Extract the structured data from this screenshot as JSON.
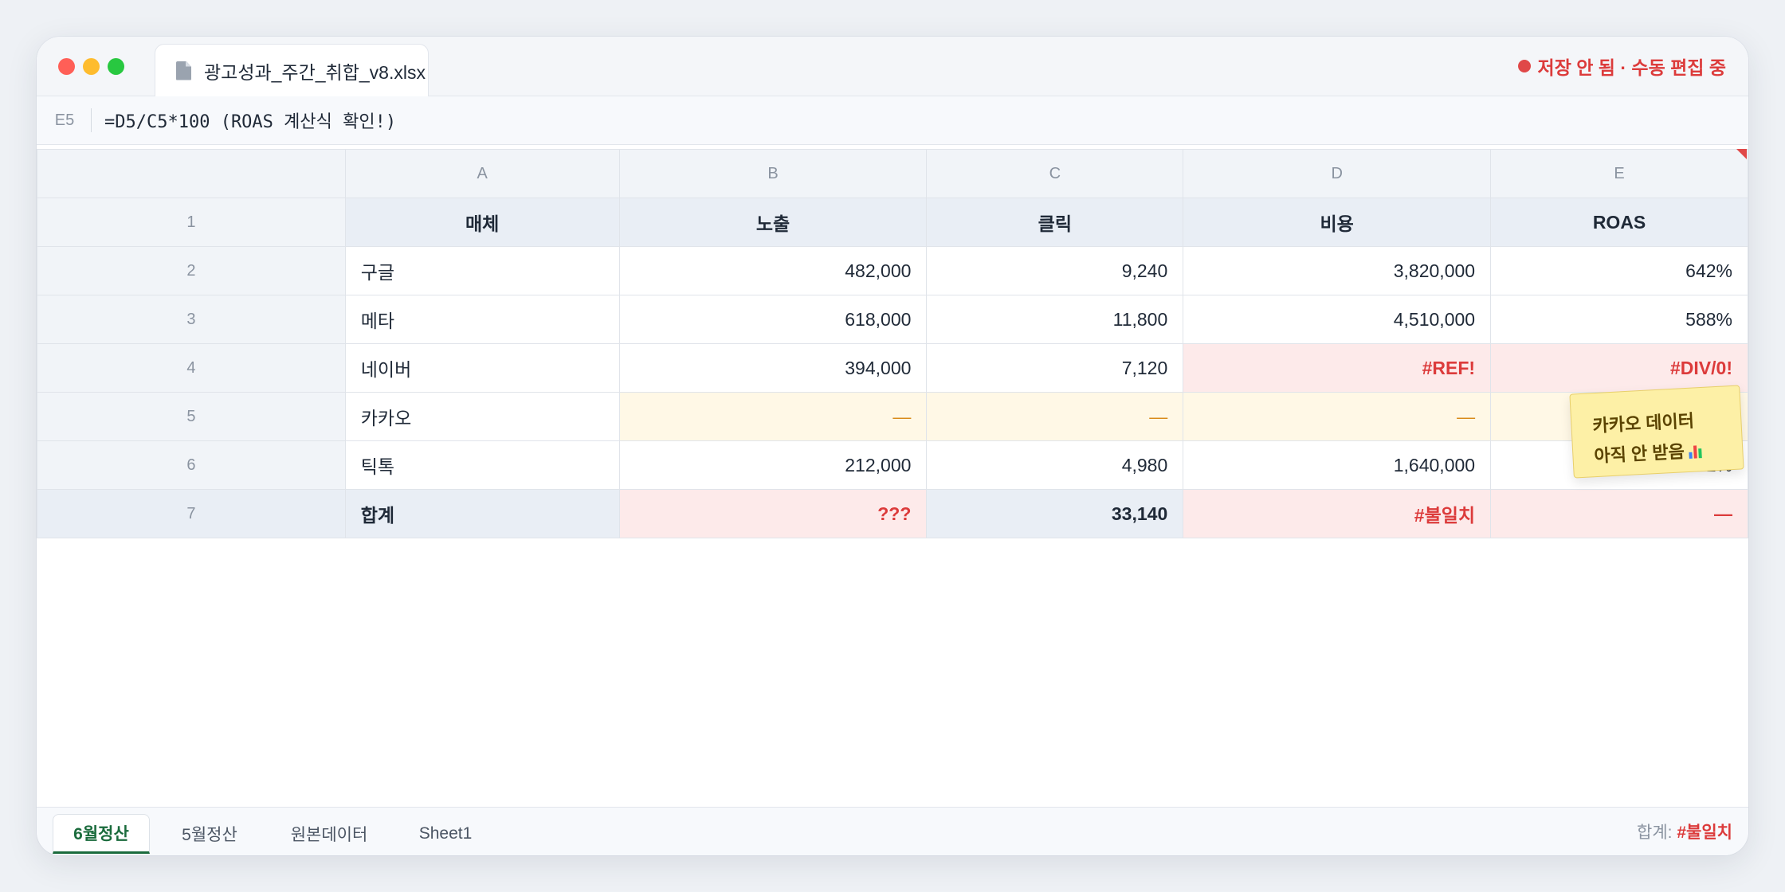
{
  "window": {
    "file_tab": "광고성과_주간_취합_v8.xlsx",
    "file_icon": "document-icon",
    "status": "저장 안 됨 · 수동 편집 중",
    "status_color": "#e04848"
  },
  "formula_bar": {
    "cell_ref": "E5",
    "formula": "=D5/C5*100 (ROAS 계산식 확인!)"
  },
  "columns": [
    "A",
    "B",
    "C",
    "D",
    "E"
  ],
  "header_row": {
    "num": "1",
    "cells": [
      "매체",
      "노출",
      "클릭",
      "비용",
      "ROAS"
    ]
  },
  "rows": [
    {
      "num": "2",
      "cells": [
        "구글",
        "482,000",
        "9,240",
        "3,820,000",
        "642%"
      ]
    },
    {
      "num": "3",
      "cells": [
        "메타",
        "618,000",
        "11,800",
        "4,510,000",
        "588%"
      ]
    },
    {
      "num": "4",
      "cells": [
        "네이버",
        "394,000",
        "7,120",
        "#REF!",
        "#DIV/0!"
      ]
    },
    {
      "num": "5",
      "cells": [
        "카카오",
        "—",
        "—",
        "—",
        "—"
      ]
    },
    {
      "num": "6",
      "cells": [
        "틱톡",
        "212,000",
        "4,980",
        "1,640,000",
        "531%"
      ]
    }
  ],
  "total_row": {
    "num": "7",
    "cells": [
      "합계",
      "???",
      "33,140",
      "#불일치",
      "—"
    ]
  },
  "sticky_note": {
    "line1": "카카오 데이터",
    "line2": "아직 안 받음",
    "icon": "bar-chart-icon"
  },
  "sheet_tabs": [
    "6월정산",
    "5월정산",
    "원본데이터",
    "Sheet1"
  ],
  "active_sheet": "6월정산",
  "footer": {
    "sum_label": "합계:",
    "sum_value": "#불일치"
  },
  "colors": {
    "error": "#dc3b3b",
    "pending": "#d98b1a",
    "active_tab": "#1a6b3c"
  }
}
